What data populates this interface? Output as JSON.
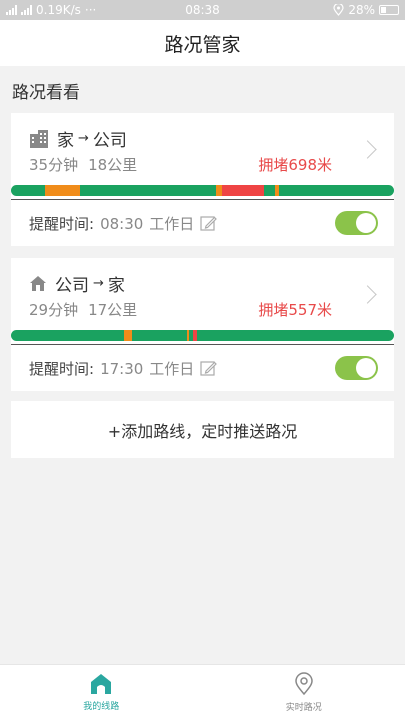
{
  "status_bar": {
    "left": "0.19K/s",
    "dots": "···",
    "time": "08:38",
    "battery": "28%"
  },
  "header": {
    "title": "路况管家"
  },
  "section": {
    "title": "路况看看"
  },
  "routes": [
    {
      "from": "家",
      "to": "公司",
      "arrow": "→",
      "duration": "35分钟",
      "distance": "18公里",
      "jam": "拥堵698米",
      "remind_label": "提醒时间:",
      "remind_time": "08:30",
      "remind_days": "工作日",
      "toggle_on": true,
      "traffic_segments": [
        {
          "status": "smooth",
          "from": 0.0,
          "to": 0.09
        },
        {
          "status": "slow",
          "from": 0.09,
          "to": 0.18
        },
        {
          "status": "smooth",
          "from": 0.18,
          "to": 0.535
        },
        {
          "status": "slow",
          "from": 0.535,
          "to": 0.55
        },
        {
          "status": "jam",
          "from": 0.55,
          "to": 0.66
        },
        {
          "status": "smooth",
          "from": 0.66,
          "to": 0.69
        },
        {
          "status": "slow",
          "from": 0.69,
          "to": 0.7
        },
        {
          "status": "smooth",
          "from": 0.7,
          "to": 1.0
        }
      ]
    },
    {
      "from": "公司",
      "to": "家",
      "arrow": "→",
      "duration": "29分钟",
      "distance": "17公里",
      "jam": "拥堵557米",
      "remind_label": "提醒时间:",
      "remind_time": "17:30",
      "remind_days": "工作日",
      "toggle_on": true,
      "traffic_segments": [
        {
          "status": "smooth",
          "from": 0.0,
          "to": 0.295
        },
        {
          "status": "slow",
          "from": 0.295,
          "to": 0.315
        },
        {
          "status": "smooth",
          "from": 0.315,
          "to": 0.46
        },
        {
          "status": "slow",
          "from": 0.46,
          "to": 0.466
        },
        {
          "status": "smooth",
          "from": 0.466,
          "to": 0.476
        },
        {
          "status": "jam",
          "from": 0.476,
          "to": 0.485
        },
        {
          "status": "smooth",
          "from": 0.485,
          "to": 1.0
        }
      ]
    }
  ],
  "add_route": {
    "label": "+添加路线，定时推送路况"
  },
  "tabbar": {
    "tabs": [
      {
        "label": "我的线路",
        "icon": "home-icon",
        "active": true
      },
      {
        "label": "实时路况",
        "icon": "location-pin-icon",
        "active": false
      }
    ]
  },
  "colors": {
    "smooth": "#1aa260",
    "slow": "#f08c1a",
    "jam": "#ef4444",
    "accent": "#2aa7a0",
    "toggle": "#8bc34a",
    "jam_text": "#e84a4a"
  }
}
